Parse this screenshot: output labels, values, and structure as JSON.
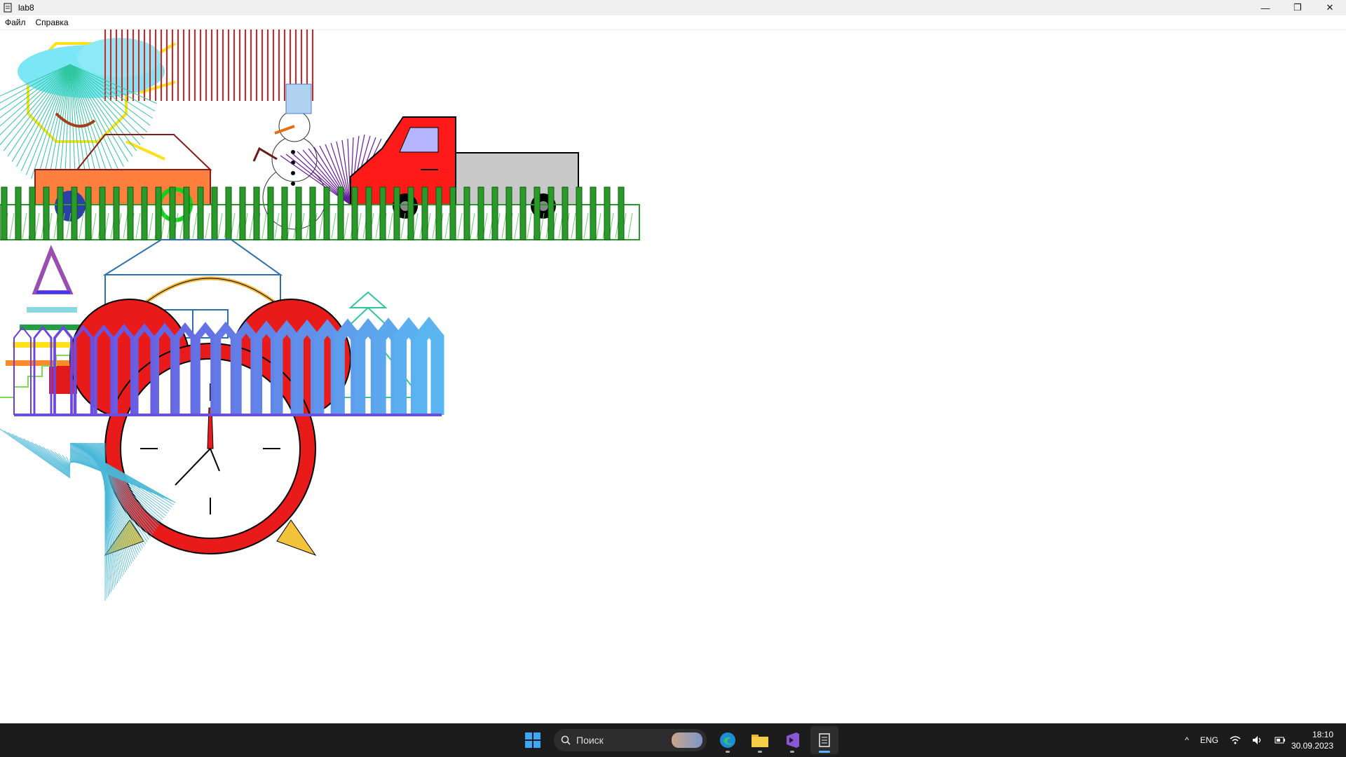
{
  "window": {
    "title": "lab8",
    "minimize": "—",
    "maximize": "❐",
    "close": "✕"
  },
  "menu": {
    "items": [
      "Файл",
      "Справка"
    ]
  },
  "canvas": {
    "description_hidden": ""
  },
  "taskbar": {
    "search_placeholder": "Поиск",
    "pinned": [
      "windows-start-icon",
      "edge-icon",
      "file-explorer-icon",
      "visual-studio-icon",
      "lab8-app-icon"
    ],
    "tray": {
      "chevron": "^",
      "language": "ENG",
      "time": "18:10",
      "date": "30.09.2023"
    }
  },
  "colors": {
    "taskbar_bg": "#1c1c1c",
    "accent": "#5fb2ff"
  }
}
